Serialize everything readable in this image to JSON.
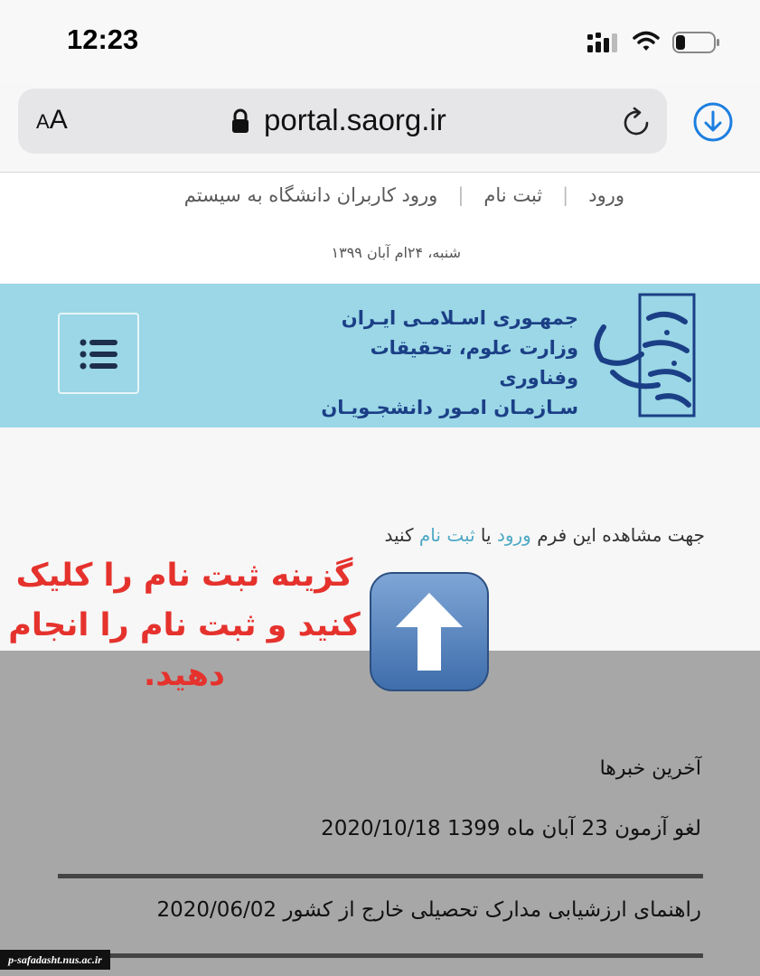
{
  "status_bar": {
    "time": "12:23",
    "signal_icon": "signal-icon",
    "wifi_icon": "wifi-icon",
    "battery_icon": "battery-icon",
    "battery_level": 0.25
  },
  "browser": {
    "text_size_label_small": "A",
    "text_size_label_large": "A",
    "url": "portal.saorg.ir",
    "lock_icon": "lock-icon",
    "reload_icon": "reload-icon",
    "download_icon": "download-icon"
  },
  "nav": {
    "login": "ورود",
    "register": "ثبت نام",
    "university_login": "ورود کاربران دانشگاه به سیستم",
    "separator": "|"
  },
  "date": "شنبه، ۲۴ام آبان ۱۳۹۹",
  "banner": {
    "logo_icon": "saorg-logo-icon",
    "line1": "جمهـوری اسـلامـی ایـران",
    "line2": "وزارت علوم، تحقیقات وفناوری",
    "line3": "سـازمـان امـور دانشجـویـان",
    "menu_icon": "hamburger-menu-icon",
    "bg_color": "#9bd7e6",
    "text_color": "#1b3f86"
  },
  "content": {
    "prompt_prefix": "جهت مشاهده این فرم",
    "login_link": "ورود",
    "or": "یا",
    "register_link": "ثبت نام",
    "prompt_suffix": "کنید",
    "link_color": "#4fa9c6"
  },
  "annotation": {
    "text": "گزینه ثبت نام را کلیک کنید و ثبت نام را انجام دهید.",
    "arrow_icon": "up-arrow-icon",
    "color": "#e5322d"
  },
  "news": {
    "title": "آخرین خبرها",
    "items": [
      "لغو آزمون 23 آبان ماه 1399 2020/10/18",
      "راهنمای ارزشیابی مدارک تحصیلی خارج از کشور 2020/06/02"
    ]
  },
  "watermark": "p-safadasht.nus.ac.ir"
}
